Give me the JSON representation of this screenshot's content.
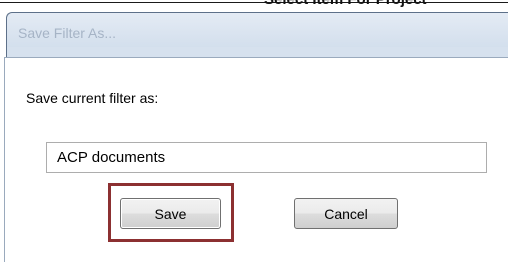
{
  "background": {
    "page_heading": "Select Item For Project"
  },
  "dialog": {
    "title": "Save Filter As...",
    "prompt": "Save current filter as:",
    "filter_name_value": "ACP documents",
    "buttons": {
      "save_label": "Save",
      "cancel_label": "Cancel"
    },
    "highlight_color": "#8c3031"
  }
}
